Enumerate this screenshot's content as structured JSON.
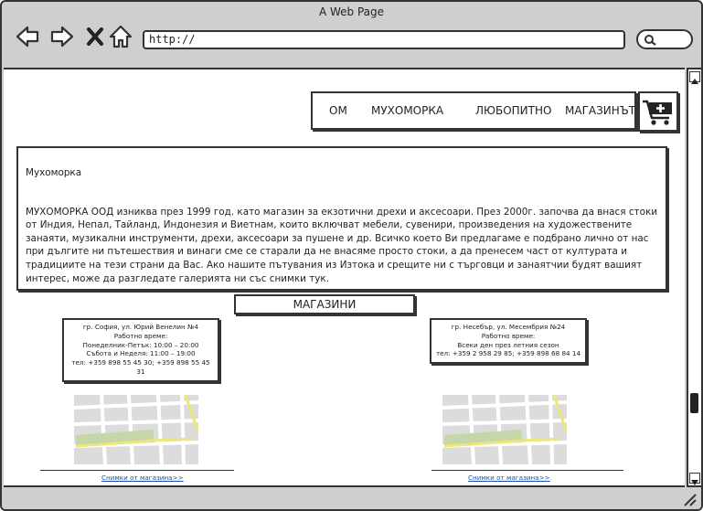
{
  "window": {
    "title": "A Web Page"
  },
  "browser": {
    "url": "http://"
  },
  "menu": {
    "items": [
      {
        "label": "ОМ"
      },
      {
        "label": "МУХОМОРКА"
      },
      {
        "label": "ЛЮБОПИТНО"
      },
      {
        "label": "МАГАЗИНЪТ"
      }
    ]
  },
  "about": {
    "title": "Мухоморка",
    "text": "МУХОМОРКА ООД изниква през 1999 год. като магазин за екзотични дрехи и аксесоари. През 2000г. започва да внася стоки от Индия, Непал, Тайланд, Индонезия и Виетнам, които включват мебели, сувенири, произведения на художествените занаяти, музикални инструменти, дрехи, аксесоари за пушене и др. Всичко което Ви предлагаме е подбрано лично от нас при дългите ни пътешествия и винаги сме се старали да не внасяме просто стоки, а да пренесем част от културата и традициите на тези страни да Вас. Ако нашите пътувания из Изтока и срещите ни с търговци и занаятчии будят вашият интерес, може да разгледате галерията ни със снимки тук."
  },
  "stores": {
    "heading": "МАГАЗИНИ",
    "list": [
      {
        "address": "гр. София, ул. Юрий Венелин №4",
        "hours_label": "Работно време:",
        "hours_1": "Понеделник-Петък: 10:00 – 20:00",
        "hours_2": "Събота и Неделя: 11:00 – 19:00",
        "phone": "тел: +359 898 55 45 30; +359 898 55 45 31",
        "link": "Снимки от магазина>>"
      },
      {
        "address": "гр. Несебър, ул. Месембрия №24",
        "hours_label": "Работно време:",
        "hours_1": "Всеки ден през летния сезон",
        "hours_2": "",
        "phone": "тел: +359 2 958 29 85; +359 898 68 84 14",
        "link": "Снимки от магазина>>"
      }
    ]
  },
  "colors": {
    "chrome": "#cfcfcf",
    "link": "#1e4fb0",
    "map_park": "#c6d6a8",
    "map_road": "#ece77a"
  },
  "icons": [
    "back-arrow-icon",
    "forward-arrow-icon",
    "close-x-icon",
    "home-icon",
    "search-icon",
    "cart-add-icon",
    "resize-grip-icon"
  ]
}
